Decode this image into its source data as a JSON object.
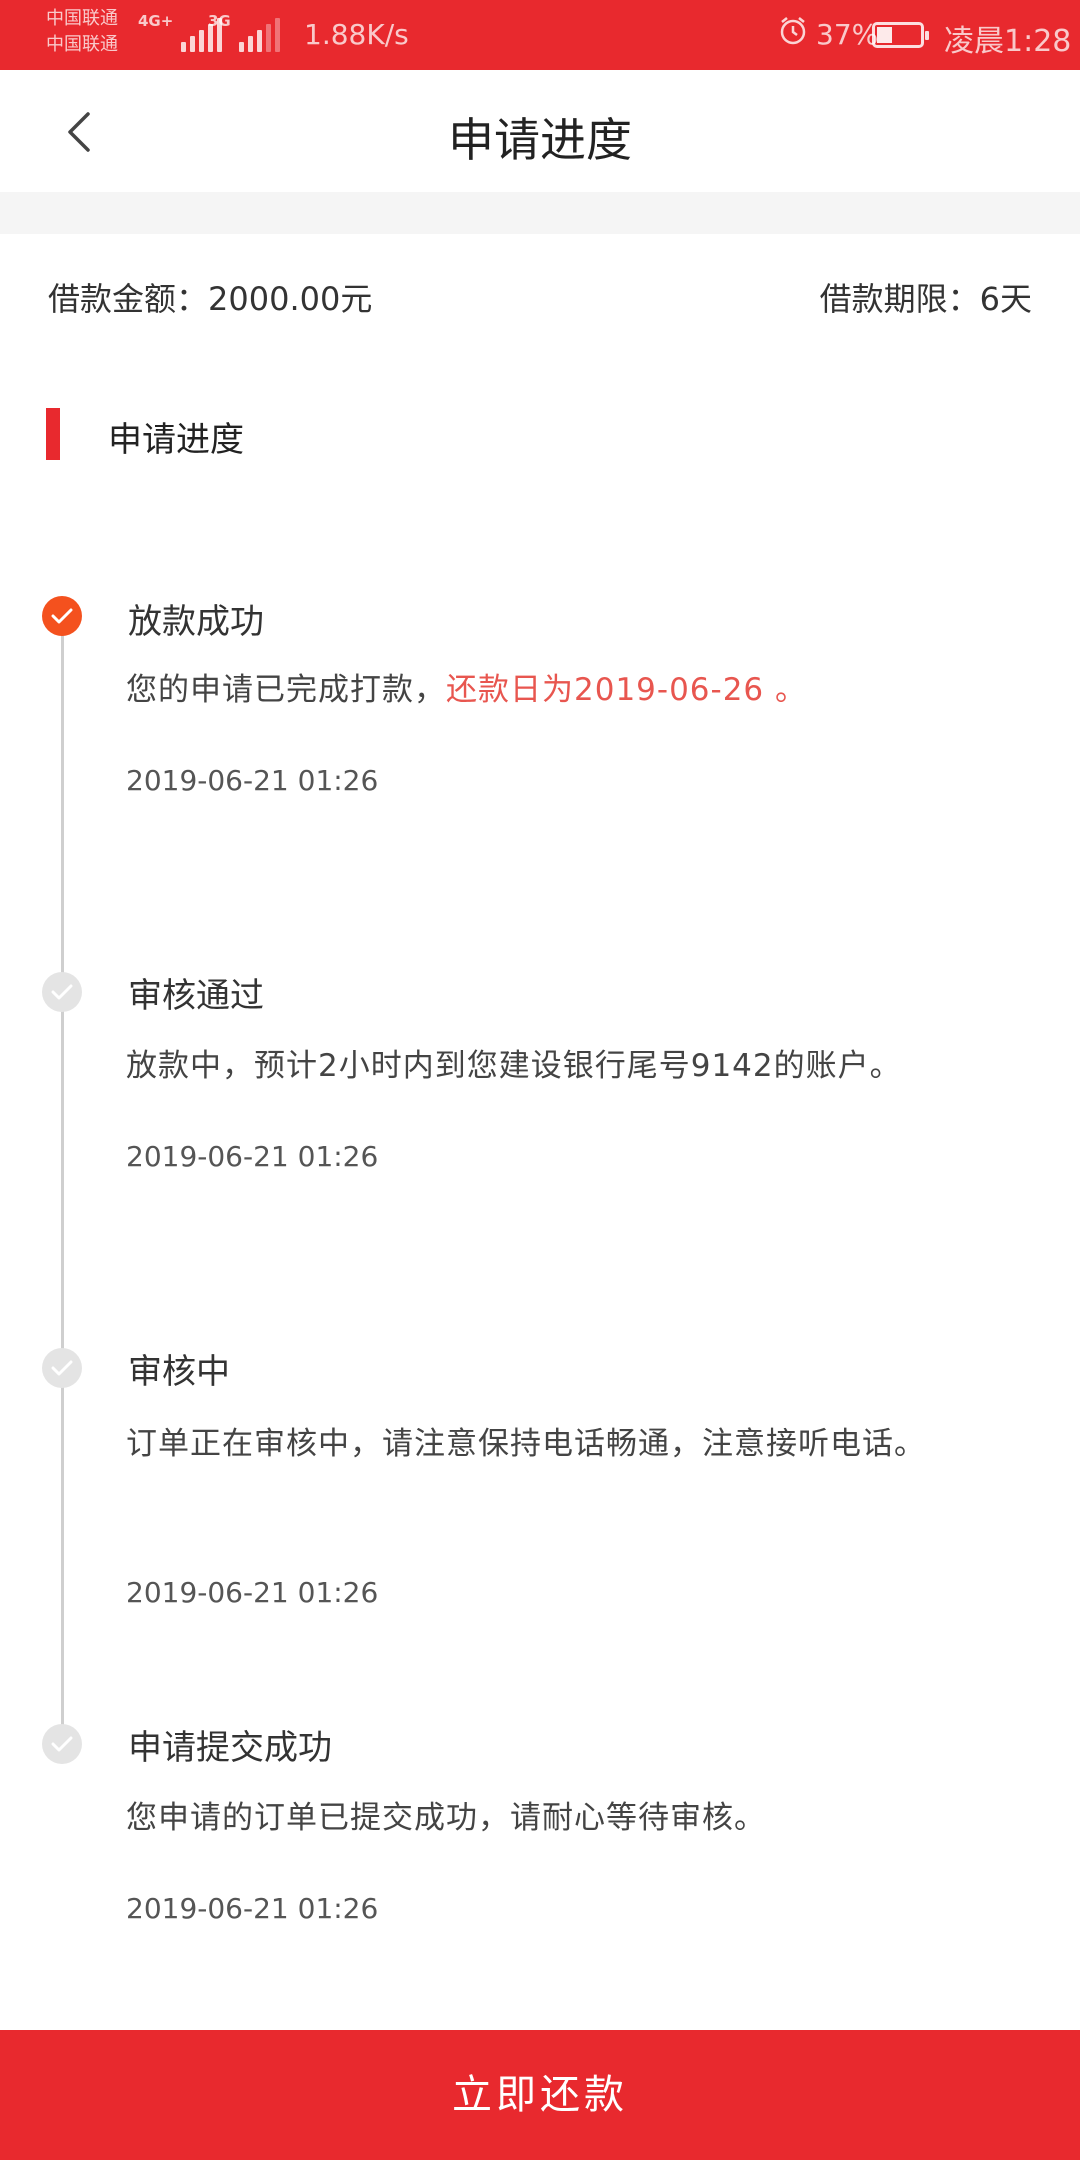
{
  "status_bar": {
    "carrier_1": "中国联通",
    "carrier_2": "中国联通",
    "net_1": "4G+",
    "net_2": "3G",
    "speed": "1.88K/s",
    "battery_pct": "37%",
    "battery_level": 0.37,
    "time": "凌晨1:28"
  },
  "header": {
    "title": "申请进度",
    "back_icon": "chevron-left-icon"
  },
  "loan": {
    "amount_text": "借款金额：2000.00元",
    "term_text": "借款期限：6天"
  },
  "section": {
    "title": "申请进度"
  },
  "steps": [
    {
      "title": "放款成功",
      "desc_plain": "您的申请已完成打款，",
      "desc_highlight": "还款日为2019-06-26 。",
      "time": "2019-06-21 01:26",
      "active": true
    },
    {
      "title": "审核通过",
      "desc_plain": "放款中，预计2小时内到您建设银行尾号9142的账户。",
      "time": "2019-06-21 01:26",
      "active": false
    },
    {
      "title": "审核中",
      "desc_plain": "订单正在审核中，请注意保持电话畅通，注意接听电话。",
      "time": "2019-06-21 01:26",
      "active": false
    },
    {
      "title": "申请提交成功",
      "desc_plain": "您申请的订单已提交成功，请耐心等待审核。",
      "time": "2019-06-21 01:26",
      "active": false
    }
  ],
  "colors": {
    "brand_red": "#e8292e",
    "active_dot": "#f4511e",
    "highlight_text": "#e8564f"
  },
  "actions": {
    "repay_label": "立即还款"
  }
}
